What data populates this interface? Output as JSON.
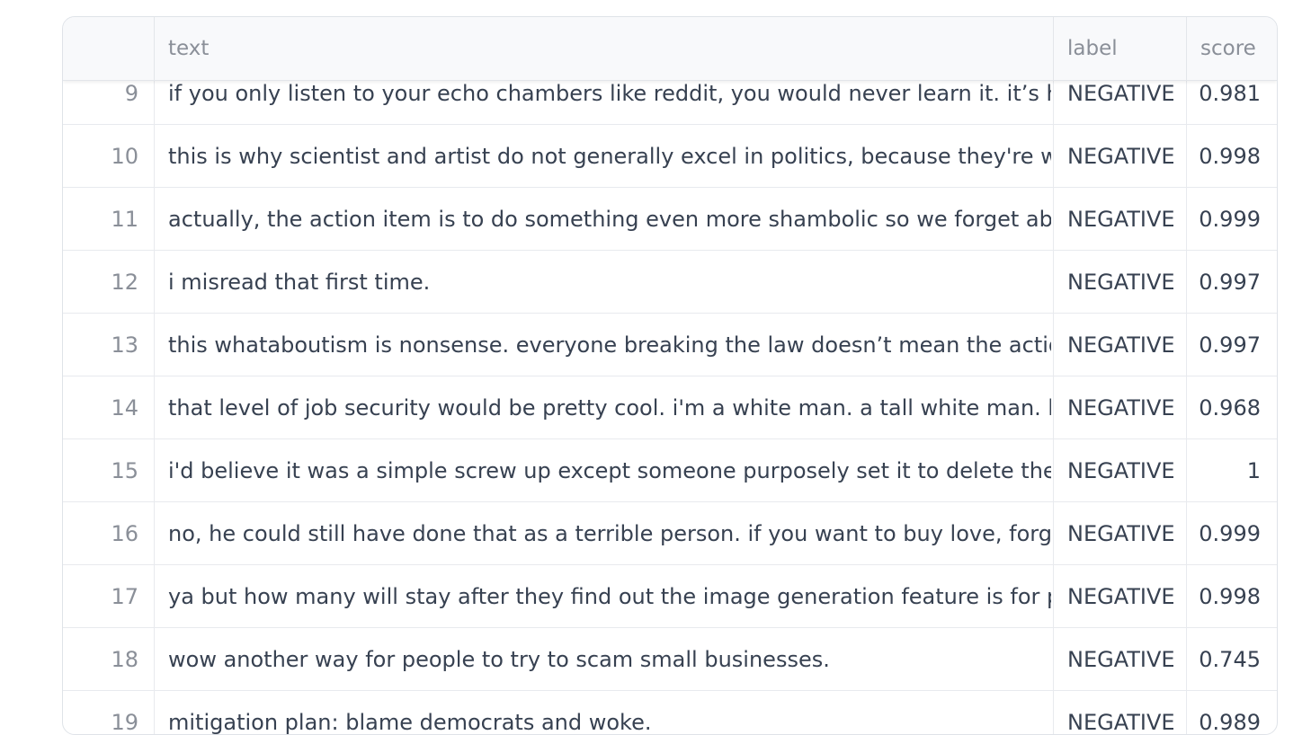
{
  "table": {
    "columns": [
      "",
      "text",
      "label",
      "score"
    ],
    "rows": [
      {
        "index": "9",
        "text": "if you only listen to your echo chambers like reddit, you would never learn it. it’s how",
        "label": "NEGATIVE",
        "score": "0.981"
      },
      {
        "index": "10",
        "text": "this is why scientist and artist do not generally excel in politics, because they're wise and",
        "label": "NEGATIVE",
        "score": "0.998"
      },
      {
        "index": "11",
        "text": "actually, the action item is to do something even more shambolic so we forget about",
        "label": "NEGATIVE",
        "score": "0.999"
      },
      {
        "index": "12",
        "text": "i misread that first time.",
        "label": "NEGATIVE",
        "score": "0.997"
      },
      {
        "index": "13",
        "text": "this whataboutism is nonsense. everyone breaking the law doesn’t mean the actions",
        "label": "NEGATIVE",
        "score": "0.997"
      },
      {
        "index": "14",
        "text": "that level of job security would be pretty cool. i'm a white man. a tall white man. but still",
        "label": "NEGATIVE",
        "score": "0.968"
      },
      {
        "index": "15",
        "text": "i'd believe it was a simple screw up except someone purposely set it to delete the content",
        "label": "NEGATIVE",
        "score": "1"
      },
      {
        "index": "16",
        "text": "no, he could still have done that as a terrible person. if you want to buy love, forgiving",
        "label": "NEGATIVE",
        "score": "0.999"
      },
      {
        "index": "17",
        "text": "ya but how many will stay after they find out the image generation feature is for paid users",
        "label": "NEGATIVE",
        "score": "0.998"
      },
      {
        "index": "18",
        "text": "wow another way for people to try to scam small businesses.",
        "label": "NEGATIVE",
        "score": "0.745"
      },
      {
        "index": "19",
        "text": "mitigation plan: blame democrats and woke.",
        "label": "NEGATIVE",
        "score": "0.989"
      }
    ]
  }
}
